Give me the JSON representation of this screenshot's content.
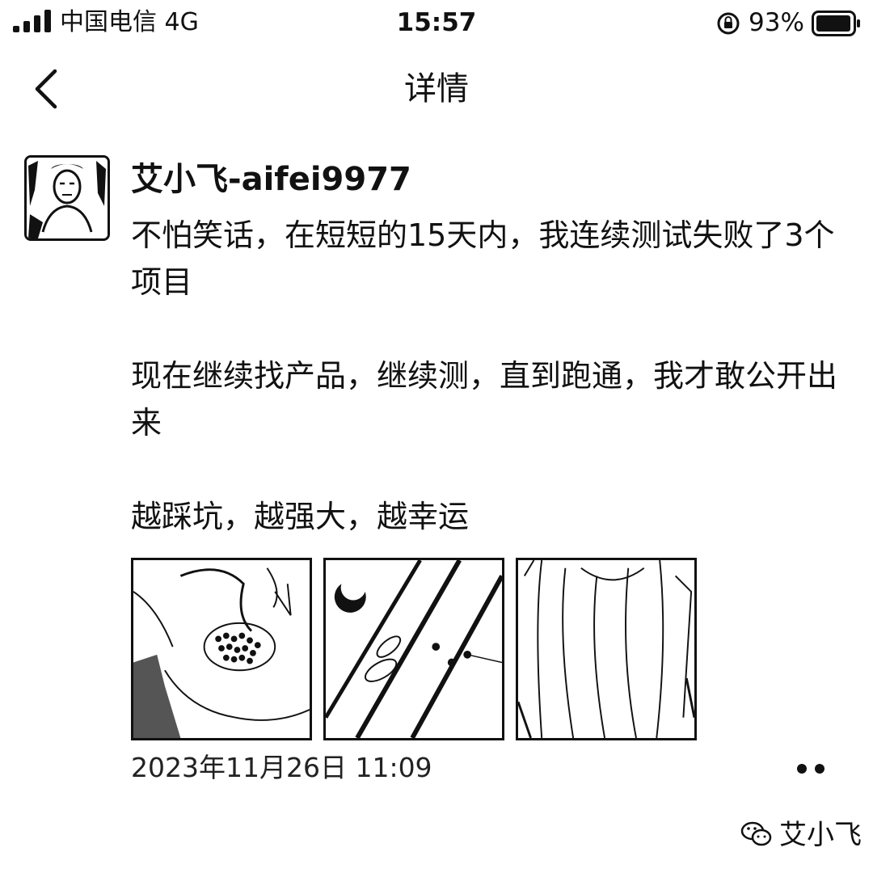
{
  "status_bar": {
    "carrier": "中国电信 4G",
    "time": "15:57",
    "battery_percent": "93%"
  },
  "nav": {
    "title": "详情"
  },
  "post": {
    "author": "艾小飞-aifei9977",
    "paragraphs": [
      "不怕笑话，在短短的15天内，我连续测试失败了3个项目",
      "现在继续找产品，继续测，直到跑通，我才敢公开出来",
      "越踩坑，越强大，越幸运"
    ],
    "photo_count": 3,
    "timestamp": "2023年11月26日 11:09"
  },
  "watermark": {
    "text": "艾小飞"
  },
  "icons": [
    "signal-icon",
    "orientation-lock-icon",
    "battery-icon",
    "back-chevron-icon",
    "more-dots-icon",
    "wechat-icon"
  ],
  "colors": {
    "text": "#111111",
    "background": "#ffffff"
  }
}
